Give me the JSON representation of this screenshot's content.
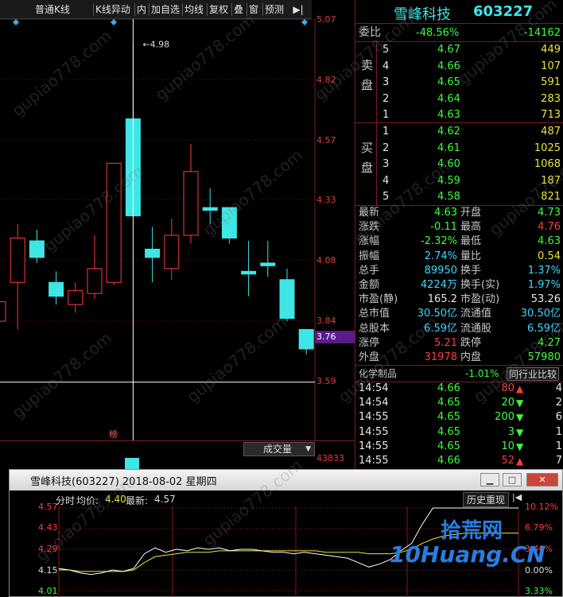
{
  "toolbar": {
    "buttons": [
      "普通K线",
      "K线异动",
      "内",
      "加自选",
      "均线",
      "复权",
      "叠",
      "窗",
      "预测"
    ],
    "next_icon": "play-next-icon"
  },
  "chart": {
    "price_ticks": [
      "5.07",
      "4.82",
      "4.57",
      "4.33",
      "4.08",
      "3.84",
      "3.59"
    ],
    "crosshair_price": "3.76",
    "high_marker": "4.98",
    "bottom_tag": "榜",
    "volume_label": "成交量",
    "volume_value": "43833",
    "watermark": "gupiao778.com"
  },
  "chart_data": {
    "type": "candlestick",
    "y_range": [
      3.55,
      5.07
    ],
    "candles": [
      {
        "o": 3.98,
        "h": 4.05,
        "l": 3.93,
        "c": 4.05
      },
      {
        "o": 4.12,
        "h": 4.33,
        "l": 3.95,
        "c": 4.28
      },
      {
        "o": 4.27,
        "h": 4.31,
        "l": 4.19,
        "c": 4.21
      },
      {
        "o": 4.12,
        "h": 4.16,
        "l": 4.04,
        "c": 4.07
      },
      {
        "o": 4.04,
        "h": 4.12,
        "l": 4.01,
        "c": 4.09
      },
      {
        "o": 4.08,
        "h": 4.29,
        "l": 4.06,
        "c": 4.17
      },
      {
        "o": 4.12,
        "h": 4.55,
        "l": 4.11,
        "c": 4.55
      },
      {
        "o": 4.71,
        "h": 4.98,
        "l": 4.35,
        "c": 4.36
      },
      {
        "o": 4.24,
        "h": 4.32,
        "l": 4.12,
        "c": 4.21
      },
      {
        "o": 4.17,
        "h": 4.35,
        "l": 4.13,
        "c": 4.29
      },
      {
        "o": 4.29,
        "h": 4.62,
        "l": 4.26,
        "c": 4.52
      },
      {
        "o": 4.39,
        "h": 4.46,
        "l": 4.33,
        "c": 4.38
      },
      {
        "o": 4.39,
        "h": 4.39,
        "l": 4.26,
        "c": 4.28
      },
      {
        "o": 4.16,
        "h": 4.27,
        "l": 4.07,
        "c": 4.15
      },
      {
        "o": 4.19,
        "h": 4.27,
        "l": 4.14,
        "c": 4.18
      },
      {
        "o": 4.13,
        "h": 4.17,
        "l": 3.98,
        "c": 3.99
      },
      {
        "o": 3.95,
        "h": 3.95,
        "l": 3.86,
        "c": 3.88
      }
    ]
  },
  "quote": {
    "name": "雪峰科技",
    "code": "603227",
    "weibi_label": "委比",
    "weibi_pct": "-48.56%",
    "weibi_val": "-14162",
    "sell_label": "卖盘",
    "buy_label": "买盘",
    "asks": [
      {
        "lvl": "5",
        "price": "4.67",
        "vol": "449"
      },
      {
        "lvl": "4",
        "price": "4.66",
        "vol": "107"
      },
      {
        "lvl": "3",
        "price": "4.65",
        "vol": "591"
      },
      {
        "lvl": "2",
        "price": "4.64",
        "vol": "283"
      },
      {
        "lvl": "1",
        "price": "4.63",
        "vol": "713"
      }
    ],
    "bids": [
      {
        "lvl": "1",
        "price": "4.62",
        "vol": "487"
      },
      {
        "lvl": "2",
        "price": "4.61",
        "vol": "1025"
      },
      {
        "lvl": "3",
        "price": "4.60",
        "vol": "1068"
      },
      {
        "lvl": "4",
        "price": "4.59",
        "vol": "187"
      },
      {
        "lvl": "5",
        "price": "4.58",
        "vol": "821"
      }
    ],
    "stats": [
      {
        "l1": "最新",
        "v1": "4.63",
        "c1": "c-green",
        "l2": "开盘",
        "v2": "4.73",
        "c2": "c-green"
      },
      {
        "l1": "涨跌",
        "v1": "-0.11",
        "c1": "c-green",
        "l2": "最高",
        "v2": "4.76",
        "c2": "c-red"
      },
      {
        "l1": "涨幅",
        "v1": "-2.32%",
        "c1": "c-green",
        "l2": "最低",
        "v2": "4.63",
        "c2": "c-green"
      },
      {
        "l1": "振幅",
        "v1": "2.74%",
        "c1": "c-cyan",
        "l2": "量比",
        "v2": "0.54",
        "c2": "c-yellow"
      },
      {
        "l1": "总手",
        "v1": "89950",
        "c1": "c-cyan",
        "l2": "换手",
        "v2": "1.37%",
        "c2": "c-cyan"
      },
      {
        "l1": "金额",
        "v1": "4224万",
        "c1": "c-cyan",
        "l2": "换手(实)",
        "v2": "1.97%",
        "c2": "c-cyan"
      },
      {
        "l1": "市盈(静)",
        "v1": "165.2",
        "c1": "c-white",
        "l2": "市盈(动)",
        "v2": "53.26",
        "c2": "c-white"
      },
      {
        "l1": "总市值",
        "v1": "30.50亿",
        "c1": "c-cyan",
        "l2": "流通值",
        "v2": "30.50亿",
        "c2": "c-cyan"
      },
      {
        "l1": "总股本",
        "v1": "6.59亿",
        "c1": "c-cyan",
        "l2": "流通股",
        "v2": "6.59亿",
        "c2": "c-cyan"
      },
      {
        "l1": "涨停",
        "v1": "5.21",
        "c1": "c-red",
        "l2": "跌停",
        "v2": "4.27",
        "c2": "c-green"
      },
      {
        "l1": "外盘",
        "v1": "31978",
        "c1": "c-red",
        "l2": "内盘",
        "v2": "57980",
        "c2": "c-green"
      }
    ],
    "industry": "化学制品",
    "industry_pct": "-1.01%",
    "compare_btn": "同行业比较",
    "ticks": [
      {
        "time": "14:54",
        "price": "4.66",
        "vol": "80",
        "dir": "up",
        "n": "4"
      },
      {
        "time": "14:54",
        "price": "4.65",
        "vol": "20",
        "dir": "down",
        "n": "2"
      },
      {
        "time": "14:55",
        "price": "4.65",
        "vol": "200",
        "dir": "down",
        "n": "6"
      },
      {
        "time": "14:55",
        "price": "4.65",
        "vol": "3",
        "dir": "down",
        "n": "1"
      },
      {
        "time": "14:55",
        "price": "4.65",
        "vol": "10",
        "dir": "down",
        "n": "1"
      },
      {
        "time": "14:55",
        "price": "4.66",
        "vol": "52",
        "dir": "up",
        "n": "7"
      }
    ]
  },
  "popup": {
    "title": "雪峰科技(603227) 2018-08-02 星期四",
    "legend_label": "分时",
    "avg_label": "均价:",
    "avg_value": "4.40",
    "last_label": "最新:",
    "last_value": "4.57",
    "history_btn": "历史重现",
    "left_ticks": [
      "4.57",
      "4.43",
      "4.29",
      "4.15",
      "4.01"
    ],
    "right_ticks": [
      "10.12%",
      "6.79%",
      "3.46%",
      "0.00%",
      "3.33%"
    ],
    "logo_text": "拾荒网",
    "logo_url": "10Huang.CN"
  },
  "colors": {
    "up": "#ff3b3b",
    "down": "#3fe6e6",
    "axis": "#7a1c1c",
    "panel_bg": "#000000"
  }
}
